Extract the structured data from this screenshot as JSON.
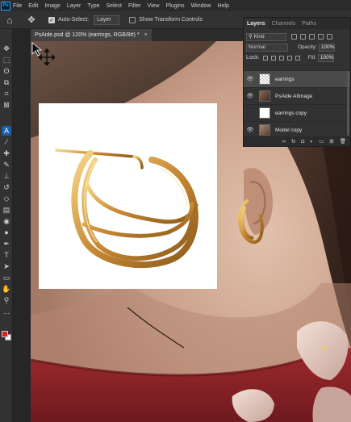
{
  "menu": {
    "logo": "Ps",
    "items": [
      "File",
      "Edit",
      "Image",
      "Layer",
      "Type",
      "Select",
      "Filter",
      "View",
      "Plugins",
      "Window",
      "Help"
    ]
  },
  "options": {
    "auto_select_label": "Auto-Select:",
    "auto_select_value": "Layer",
    "transform_label": "Show Transform Controls"
  },
  "document": {
    "tab_title": "PsAide.psd @ 120% (earrings, RGB/8#) *",
    "close": "×"
  },
  "colors": {
    "foreground": "#e41b1b",
    "background": "#ffffff",
    "accent": "#1c5fa8"
  },
  "layers_panel": {
    "tabs": [
      "Layers",
      "Channels",
      "Paths"
    ],
    "filter_label": "Kind",
    "blend_mode": "Normal",
    "opacity_label": "Opacity:",
    "opacity_value": "100%",
    "lock_label": "Lock:",
    "fill_label": "Fill:",
    "fill_value": "100%",
    "layers": [
      {
        "name": "earrings",
        "thumb": "checker",
        "selected": true
      },
      {
        "name": "PsAide AIImage",
        "thumb": "photo",
        "selected": false
      },
      {
        "name": "earrings copy",
        "thumb": "white",
        "selected": false
      },
      {
        "name": "Model copy",
        "thumb": "model",
        "selected": false
      }
    ],
    "footer_icons": [
      "link-icon",
      "fx-icon",
      "mask-icon",
      "adjustment-icon",
      "group-icon",
      "new-layer-icon",
      "trash-icon"
    ],
    "footer_glyphs": [
      "∞",
      "fx",
      "◘",
      "◐",
      "▭",
      "⊞",
      "🗑"
    ]
  },
  "tools": [
    {
      "name": "move-tool-icon",
      "glyph": "✥"
    },
    {
      "name": "marquee-tool-icon",
      "glyph": "⬚"
    },
    {
      "name": "lasso-tool-icon",
      "glyph": "ʘ"
    },
    {
      "name": "object-select-tool-icon",
      "glyph": "⧉"
    },
    {
      "name": "crop-tool-icon",
      "glyph": "⌗"
    },
    {
      "name": "frame-tool-icon",
      "glyph": "⊠"
    },
    {
      "name": "ai-tool-icon",
      "glyph": "A",
      "active": true
    },
    {
      "name": "eyedropper-tool-icon",
      "glyph": "⁄"
    },
    {
      "name": "healing-tool-icon",
      "glyph": "✚"
    },
    {
      "name": "brush-tool-icon",
      "glyph": "✎"
    },
    {
      "name": "stamp-tool-icon",
      "glyph": "⊥"
    },
    {
      "name": "history-brush-icon",
      "glyph": "↺"
    },
    {
      "name": "eraser-tool-icon",
      "glyph": "◇"
    },
    {
      "name": "gradient-tool-icon",
      "glyph": "▤"
    },
    {
      "name": "blur-tool-icon",
      "glyph": "◉"
    },
    {
      "name": "dodge-tool-icon",
      "glyph": "●"
    },
    {
      "name": "pen-tool-icon",
      "glyph": "✒"
    },
    {
      "name": "type-tool-icon",
      "glyph": "T"
    },
    {
      "name": "path-select-tool-icon",
      "glyph": "➤"
    },
    {
      "name": "shape-tool-icon",
      "glyph": "▭"
    },
    {
      "name": "hand-tool-icon",
      "glyph": "✋"
    },
    {
      "name": "zoom-tool-icon",
      "glyph": "⚲"
    },
    {
      "name": "more-tools-icon",
      "glyph": "…"
    }
  ]
}
